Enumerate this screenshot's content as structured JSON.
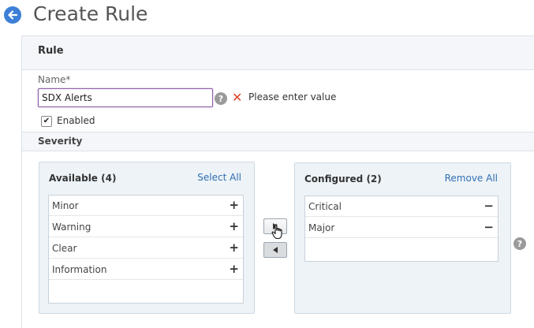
{
  "header": {
    "title": "Create Rule",
    "back_icon": "arrow-left-icon",
    "accent": "#3d7fd6"
  },
  "rule": {
    "heading": "Rule",
    "name_label": "Name*",
    "name_value": "SDX Alerts",
    "error_message": "Please enter value",
    "help_glyph": "?",
    "enabled_label": "Enabled",
    "enabled_checked": true
  },
  "severity": {
    "label": "Severity",
    "available": {
      "title": "Available (4)",
      "action": "Select All",
      "items": [
        {
          "label": "Minor"
        },
        {
          "label": "Warning"
        },
        {
          "label": "Clear"
        },
        {
          "label": "Information"
        }
      ]
    },
    "configured": {
      "title": "Configured (2)",
      "action": "Remove All",
      "items": [
        {
          "label": "Critical"
        },
        {
          "label": "Major"
        }
      ]
    },
    "add_glyph": "+",
    "remove_glyph": "−"
  },
  "colors": {
    "error": "#e0432b",
    "link": "#2f6fb3",
    "input_focus": "#8c5ca8"
  }
}
